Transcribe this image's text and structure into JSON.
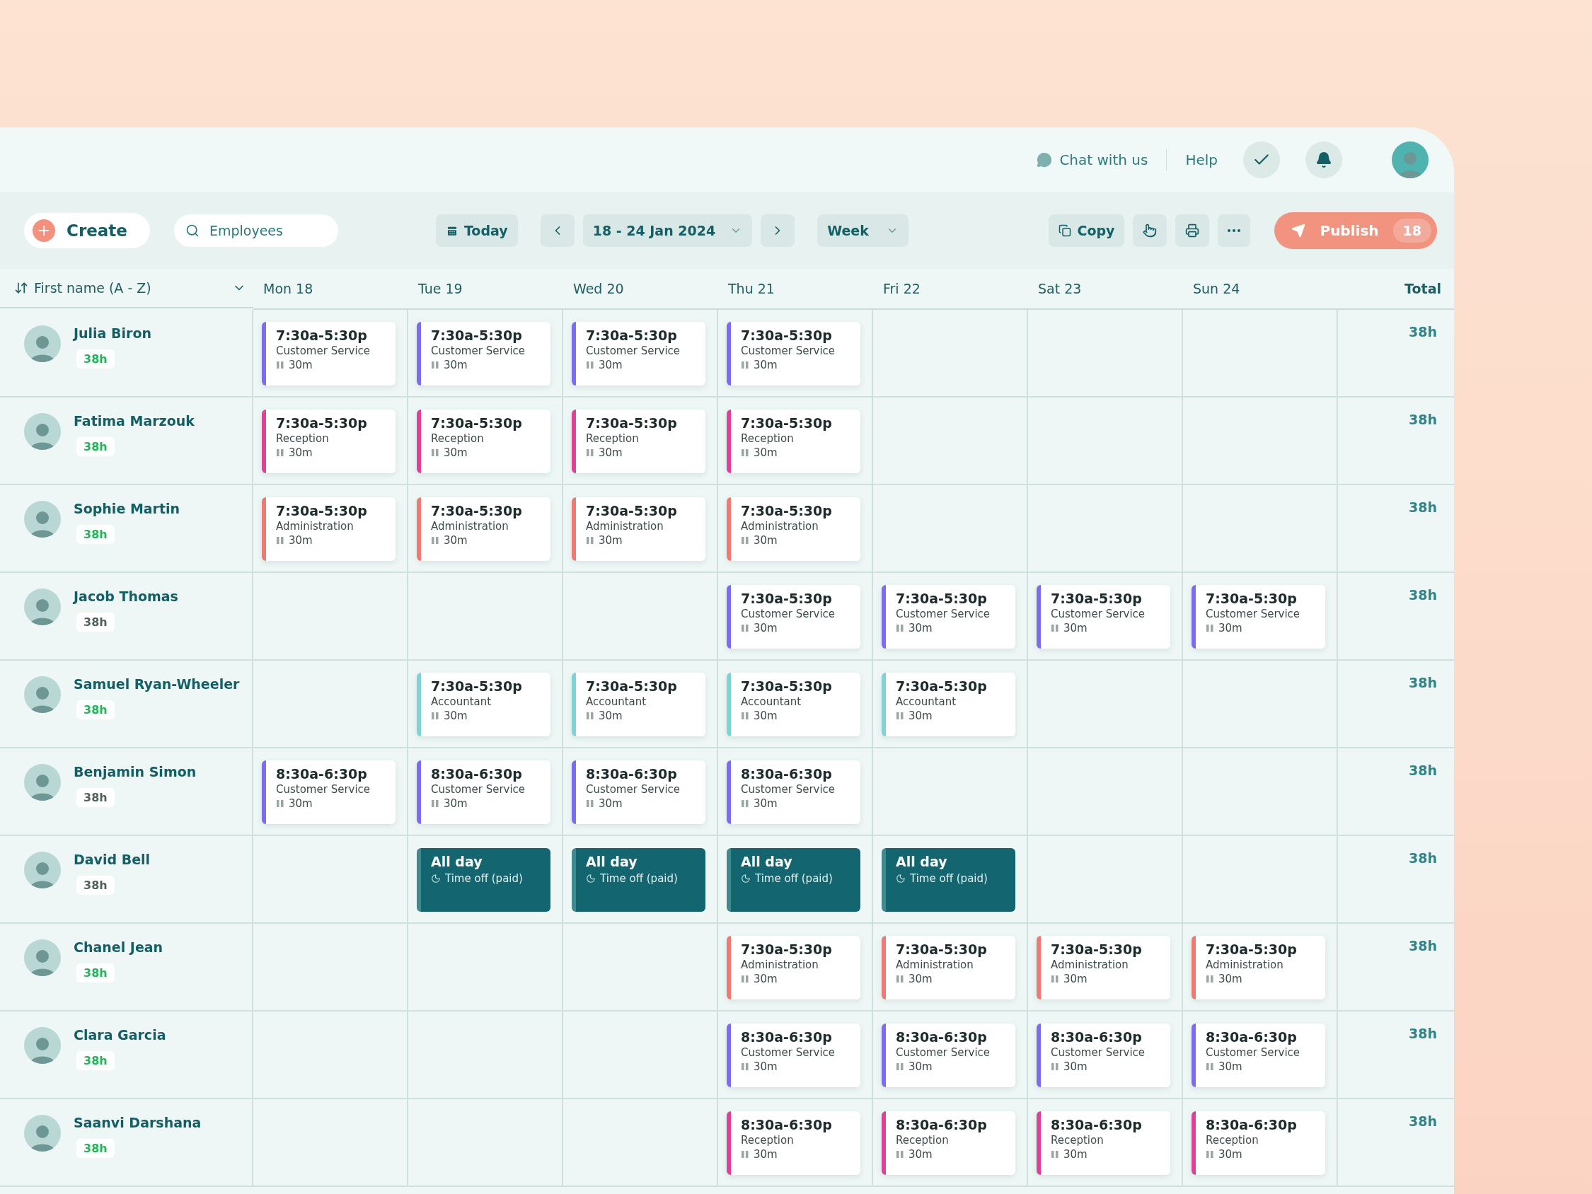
{
  "topbar": {
    "chat": "Chat with us",
    "help": "Help"
  },
  "toolbar": {
    "create": "Create",
    "search_placeholder": "Employees",
    "today": "Today",
    "range": "18 - 24 Jan 2024",
    "view": "Week",
    "copy": "Copy",
    "publish": "Publish",
    "publish_count": "18"
  },
  "table": {
    "sort_label": "First name (A - Z)",
    "days": [
      "Mon 18",
      "Tue 19",
      "Wed 20",
      "Thu 21",
      "Fri 22",
      "Sat 23",
      "Sun 24"
    ],
    "total_label": "Total",
    "rows": [
      {
        "name": "Julia Biron",
        "hours": {
          "text": "38h",
          "color": "#22b55a"
        },
        "total": "38h",
        "cells": [
          {
            "kind": "shift",
            "time": "7:30a-5:30p",
            "role": "Customer Service",
            "break": "30m",
            "color": "#7b6cf0"
          },
          {
            "kind": "shift",
            "time": "7:30a-5:30p",
            "role": "Customer Service",
            "break": "30m",
            "color": "#7b6cf0"
          },
          {
            "kind": "shift",
            "time": "7:30a-5:30p",
            "role": "Customer Service",
            "break": "30m",
            "color": "#7b6cf0"
          },
          {
            "kind": "shift",
            "time": "7:30a-5:30p",
            "role": "Customer Service",
            "break": "30m",
            "color": "#7b6cf0"
          },
          {
            "kind": "empty"
          },
          {
            "kind": "empty"
          },
          {
            "kind": "empty"
          }
        ]
      },
      {
        "name": "Fatima Marzouk",
        "hours": {
          "text": "38h",
          "color": "#22b55a"
        },
        "total": "38h",
        "cells": [
          {
            "kind": "shift",
            "time": "7:30a-5:30p",
            "role": "Reception",
            "break": "30m",
            "color": "#e0409a"
          },
          {
            "kind": "shift",
            "time": "7:30a-5:30p",
            "role": "Reception",
            "break": "30m",
            "color": "#e0409a"
          },
          {
            "kind": "shift",
            "time": "7:30a-5:30p",
            "role": "Reception",
            "break": "30m",
            "color": "#e0409a"
          },
          {
            "kind": "shift",
            "time": "7:30a-5:30p",
            "role": "Reception",
            "break": "30m",
            "color": "#e0409a"
          },
          {
            "kind": "empty"
          },
          {
            "kind": "empty"
          },
          {
            "kind": "empty"
          }
        ]
      },
      {
        "name": "Sophie Martin",
        "hours": {
          "text": "38h",
          "color": "#22b55a"
        },
        "total": "38h",
        "cells": [
          {
            "kind": "shift",
            "time": "7:30a-5:30p",
            "role": "Administration",
            "break": "30m",
            "color": "#f07a72"
          },
          {
            "kind": "shift",
            "time": "7:30a-5:30p",
            "role": "Administration",
            "break": "30m",
            "color": "#f07a72"
          },
          {
            "kind": "shift",
            "time": "7:30a-5:30p",
            "role": "Administration",
            "break": "30m",
            "color": "#f07a72"
          },
          {
            "kind": "shift",
            "time": "7:30a-5:30p",
            "role": "Administration",
            "break": "30m",
            "color": "#f07a72"
          },
          {
            "kind": "empty"
          },
          {
            "kind": "empty"
          },
          {
            "kind": "empty"
          }
        ]
      },
      {
        "name": "Jacob Thomas",
        "hours": {
          "text": "38h",
          "color": "#52625f"
        },
        "total": "38h",
        "cells": [
          {
            "kind": "empty"
          },
          {
            "kind": "empty"
          },
          {
            "kind": "empty"
          },
          {
            "kind": "shift",
            "time": "7:30a-5:30p",
            "role": "Customer Service",
            "break": "30m",
            "color": "#7b6cf0"
          },
          {
            "kind": "shift",
            "time": "7:30a-5:30p",
            "role": "Customer Service",
            "break": "30m",
            "color": "#7b6cf0"
          },
          {
            "kind": "shift",
            "time": "7:30a-5:30p",
            "role": "Customer Service",
            "break": "30m",
            "color": "#7b6cf0"
          },
          {
            "kind": "shift",
            "time": "7:30a-5:30p",
            "role": "Customer Service",
            "break": "30m",
            "color": "#7b6cf0"
          }
        ]
      },
      {
        "name": "Samuel Ryan-Wheeler",
        "hours": {
          "text": "38h",
          "color": "#22b55a"
        },
        "total": "38h",
        "cells": [
          {
            "kind": "empty"
          },
          {
            "kind": "shift",
            "time": "7:30a-5:30p",
            "role": "Accountant",
            "break": "30m",
            "color": "#7fd3d6"
          },
          {
            "kind": "shift",
            "time": "7:30a-5:30p",
            "role": "Accountant",
            "break": "30m",
            "color": "#7fd3d6"
          },
          {
            "kind": "shift",
            "time": "7:30a-5:30p",
            "role": "Accountant",
            "break": "30m",
            "color": "#7fd3d6"
          },
          {
            "kind": "shift",
            "time": "7:30a-5:30p",
            "role": "Accountant",
            "break": "30m",
            "color": "#7fd3d6"
          },
          {
            "kind": "empty"
          },
          {
            "kind": "empty"
          }
        ]
      },
      {
        "name": "Benjamin Simon",
        "hours": {
          "text": "38h",
          "color": "#52625f"
        },
        "total": "38h",
        "cells": [
          {
            "kind": "shift",
            "time": "8:30a-6:30p",
            "role": "Customer Service",
            "break": "30m",
            "color": "#7b6cf0"
          },
          {
            "kind": "shift",
            "time": "8:30a-6:30p",
            "role": "Customer Service",
            "break": "30m",
            "color": "#7b6cf0"
          },
          {
            "kind": "shift",
            "time": "8:30a-6:30p",
            "role": "Customer Service",
            "break": "30m",
            "color": "#7b6cf0"
          },
          {
            "kind": "shift",
            "time": "8:30a-6:30p",
            "role": "Customer Service",
            "break": "30m",
            "color": "#7b6cf0"
          },
          {
            "kind": "empty"
          },
          {
            "kind": "empty"
          },
          {
            "kind": "empty"
          }
        ]
      },
      {
        "name": "David Bell",
        "hours": {
          "text": "38h",
          "color": "#52625f"
        },
        "total": "38h",
        "cells": [
          {
            "kind": "empty"
          },
          {
            "kind": "time_off",
            "time": "All day",
            "role": "Time off (paid)"
          },
          {
            "kind": "time_off",
            "time": "All day",
            "role": "Time off (paid)"
          },
          {
            "kind": "time_off",
            "time": "All day",
            "role": "Time off (paid)"
          },
          {
            "kind": "time_off",
            "time": "All day",
            "role": "Time off (paid)"
          },
          {
            "kind": "empty"
          },
          {
            "kind": "empty"
          }
        ]
      },
      {
        "name": "Chanel Jean",
        "hours": {
          "text": "38h",
          "color": "#22b55a"
        },
        "total": "38h",
        "cells": [
          {
            "kind": "empty"
          },
          {
            "kind": "empty"
          },
          {
            "kind": "empty"
          },
          {
            "kind": "shift",
            "time": "7:30a-5:30p",
            "role": "Administration",
            "break": "30m",
            "color": "#f07a72"
          },
          {
            "kind": "shift",
            "time": "7:30a-5:30p",
            "role": "Administration",
            "break": "30m",
            "color": "#f07a72"
          },
          {
            "kind": "shift",
            "time": "7:30a-5:30p",
            "role": "Administration",
            "break": "30m",
            "color": "#f07a72"
          },
          {
            "kind": "shift",
            "time": "7:30a-5:30p",
            "role": "Administration",
            "break": "30m",
            "color": "#f07a72"
          }
        ]
      },
      {
        "name": "Clara Garcia",
        "hours": {
          "text": "38h",
          "color": "#22b55a"
        },
        "total": "38h",
        "cells": [
          {
            "kind": "empty"
          },
          {
            "kind": "empty"
          },
          {
            "kind": "empty"
          },
          {
            "kind": "shift",
            "time": "8:30a-6:30p",
            "role": "Customer Service",
            "break": "30m",
            "color": "#7b6cf0"
          },
          {
            "kind": "shift",
            "time": "8:30a-6:30p",
            "role": "Customer Service",
            "break": "30m",
            "color": "#7b6cf0"
          },
          {
            "kind": "shift",
            "time": "8:30a-6:30p",
            "role": "Customer Service",
            "break": "30m",
            "color": "#7b6cf0"
          },
          {
            "kind": "shift",
            "time": "8:30a-6:30p",
            "role": "Customer Service",
            "break": "30m",
            "color": "#7b6cf0"
          }
        ]
      },
      {
        "name": "Saanvi  Darshana",
        "hours": {
          "text": "38h",
          "color": "#22b55a"
        },
        "total": "38h",
        "cells": [
          {
            "kind": "empty"
          },
          {
            "kind": "empty"
          },
          {
            "kind": "empty"
          },
          {
            "kind": "shift",
            "time": "8:30a-6:30p",
            "role": "Reception",
            "break": "30m",
            "color": "#e0409a"
          },
          {
            "kind": "shift",
            "time": "8:30a-6:30p",
            "role": "Reception",
            "break": "30m",
            "color": "#e0409a"
          },
          {
            "kind": "shift",
            "time": "8:30a-6:30p",
            "role": "Reception",
            "break": "30m",
            "color": "#e0409a"
          },
          {
            "kind": "shift",
            "time": "8:30a-6:30p",
            "role": "Reception",
            "break": "30m",
            "color": "#e0409a"
          }
        ]
      }
    ]
  }
}
